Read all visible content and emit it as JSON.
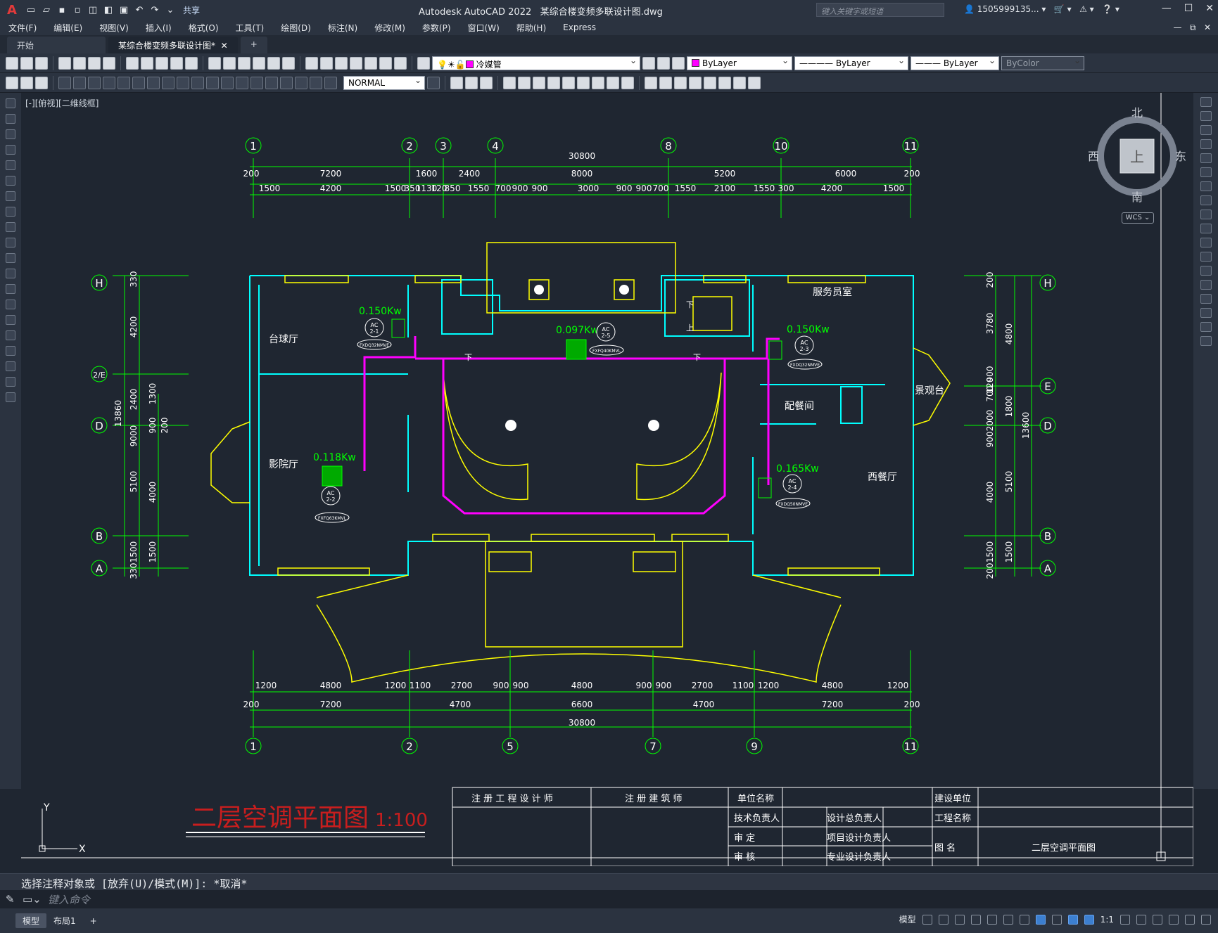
{
  "app": {
    "title": "Autodesk AutoCAD 2022",
    "file": "某综合楼变频多联设计图.dwg",
    "share": "共享",
    "search_placeholder": "键入关键字或短语",
    "user": "1505999135..."
  },
  "menu": [
    "文件(F)",
    "编辑(E)",
    "视图(V)",
    "插入(I)",
    "格式(O)",
    "工具(T)",
    "绘图(D)",
    "标注(N)",
    "修改(M)",
    "参数(P)",
    "窗口(W)",
    "帮助(H)",
    "Express"
  ],
  "tabs": [
    "开始",
    "某综合楼变频多联设计图*"
  ],
  "toolbar": {
    "layer": "冷媒管",
    "color": "ByLayer",
    "linetype": "ByLayer",
    "lineweight": "ByLayer",
    "plotstyle": "ByColor",
    "dimstyle": "NORMAL"
  },
  "viewport": {
    "label": "[-][俯视][二维线框]"
  },
  "viewcube": {
    "north": "北",
    "south": "南",
    "east": "东",
    "west": "西",
    "face": "上",
    "wcs": "WCS"
  },
  "drawing": {
    "title": "二层空调平面图",
    "scale": "1:100",
    "top_axes": [
      "1",
      "2",
      "3",
      "4",
      "8",
      "10",
      "11"
    ],
    "bottom_axes": [
      "1",
      "2",
      "5",
      "7",
      "9",
      "11"
    ],
    "left_axes": [
      "H",
      "2/E",
      "D",
      "B",
      "A"
    ],
    "right_axes": [
      "H",
      "E",
      "D",
      "B",
      "A"
    ],
    "top_total": "30800",
    "top_row1": [
      "200",
      "7200",
      "1600",
      "2400",
      "8000",
      "5200",
      "6000",
      "200"
    ],
    "top_row2": [
      "1500",
      "4200",
      "1500",
      "350",
      "1130",
      "120",
      "850",
      "1550",
      "700",
      "900",
      "900",
      "3000",
      "900",
      "900",
      "700",
      "1550",
      "2100",
      "1550",
      "300",
      "4200",
      "1500"
    ],
    "bottom_row1": [
      "1200",
      "4800",
      "1200",
      "1100",
      "2700",
      "900",
      "900",
      "4800",
      "900",
      "900",
      "2700",
      "1100",
      "1200",
      "4800",
      "1200"
    ],
    "bottom_row2": [
      "200",
      "7200",
      "4700",
      "6600",
      "4700",
      "7200",
      "200"
    ],
    "bottom_total": "30800",
    "left_outer": [
      "330",
      "4200",
      "2400",
      "9000",
      "5100",
      "1500",
      "330"
    ],
    "left_inner": [
      "1300",
      "900",
      "200",
      "4000",
      "1500"
    ],
    "left_total": "13860",
    "right_outer": [
      "200",
      "3780",
      "900",
      "120",
      "700",
      "2000",
      "900",
      "4000",
      "1500",
      "200"
    ],
    "right_inner": [
      "4800",
      "1800",
      "5100",
      "1500"
    ],
    "right_total": "13600",
    "rooms": [
      "台球厅",
      "影院厅",
      "服务员室",
      "配餐间",
      "西餐厅",
      "景观台"
    ],
    "units": [
      {
        "power": "0.150Kw",
        "tag": "AC",
        "num": "2-1",
        "model": "FXDQ32NMVE"
      },
      {
        "power": "0.118Kw",
        "tag": "AC",
        "num": "2-2",
        "model": "FXFQ63KMVL"
      },
      {
        "power": "0.097Kw",
        "tag": "AC",
        "num": "2-5",
        "model": "FXFQ40KMVL"
      },
      {
        "power": "0.150Kw",
        "tag": "AC",
        "num": "2-3",
        "model": "FXDQ32NMVE"
      },
      {
        "power": "0.165Kw",
        "tag": "AC",
        "num": "2-4",
        "model": "FXDQ50NMVE"
      }
    ],
    "stair_down": "下",
    "stair_up": "上"
  },
  "titleblock": {
    "col1": "注 册 工 程 设 计 师",
    "col2": "注 册 建 筑 师",
    "unit_name": "单位名称",
    "tech_lead": "技术负责人",
    "review": "审  定",
    "check": "审  核",
    "design_lead": "设计总负责人",
    "project_lead": "项目设计负责人",
    "prof_lead": "专业设计负责人",
    "client": "建设单位",
    "project": "工程名称",
    "drawing_name_label": "图  名",
    "drawing_name": "二层空调平面图"
  },
  "ucs": {
    "x": "X",
    "y": "Y"
  },
  "command": {
    "history": "选择注释对象或 [放弃(U)/模式(M)]: *取消*",
    "placeholder": "键入命令"
  },
  "status": {
    "tabs": [
      "模型",
      "布局1"
    ],
    "model": "模型",
    "scale": "1:1"
  },
  "colors": {
    "axis": "#00ff00",
    "wall": "#00ffff",
    "window": "#ffff00",
    "pipe": "#ff00ff",
    "title": "#c81e1e"
  }
}
